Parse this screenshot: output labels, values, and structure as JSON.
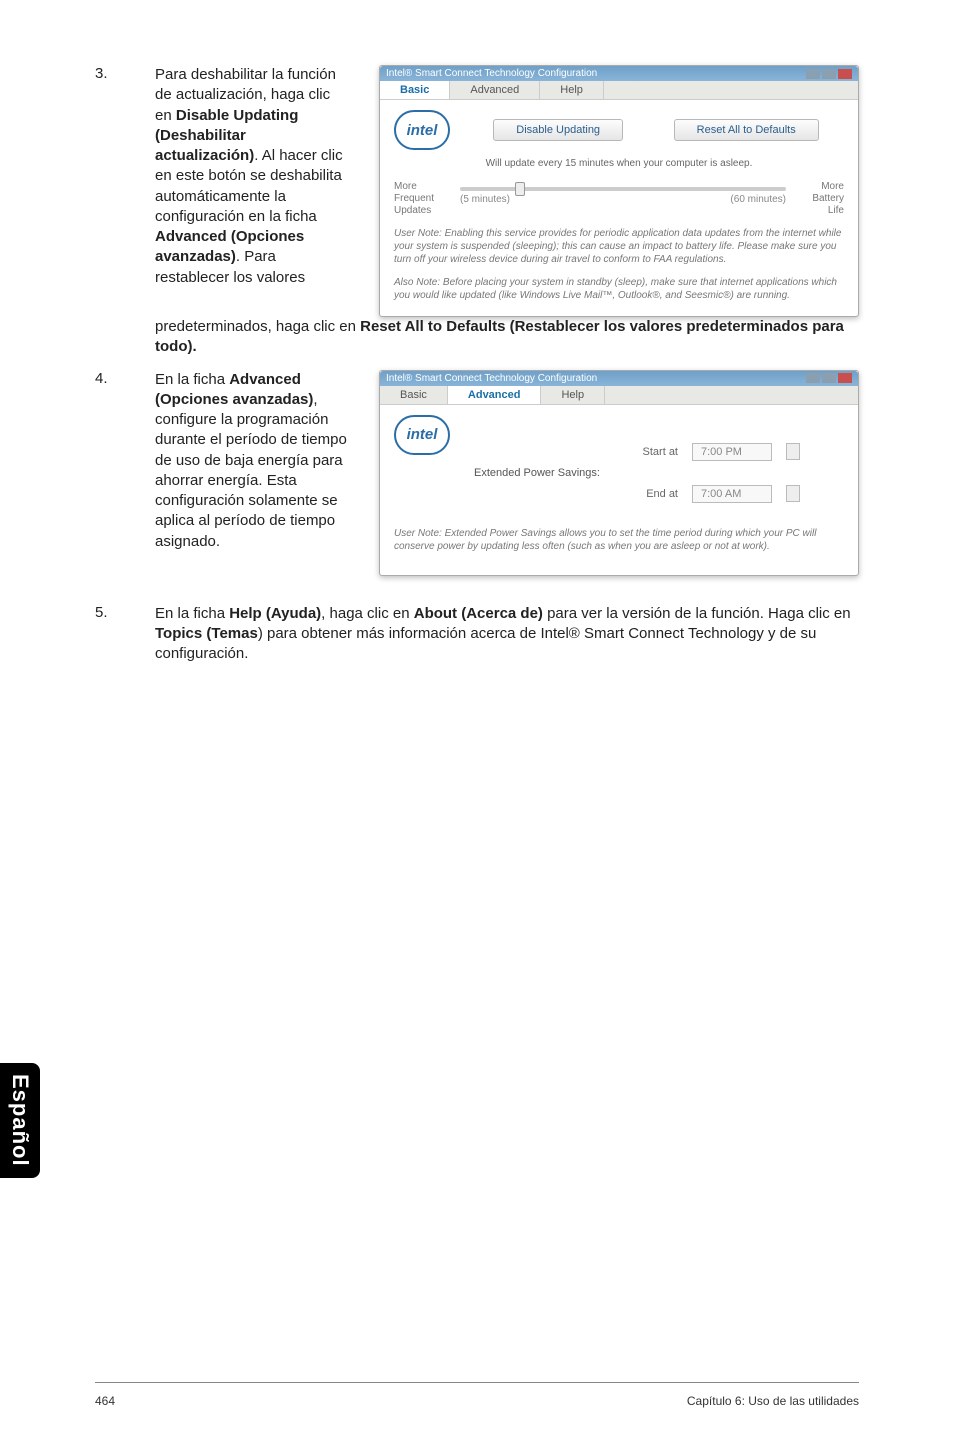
{
  "step3": {
    "num": "3.",
    "text_before": "Para deshabilitar la función de actualización, haga clic en ",
    "bold1": "Disable Updating (Deshabilitar actualización)",
    "text_mid": ". Al hacer clic en este botón se deshabilita automáticamente la configuración en la ficha ",
    "bold2": "Advanced (Opciones avanzadas)",
    "text_after": ". Para restablecer los valores",
    "wide_before": "predeterminados, haga clic en ",
    "bold3": "Reset All to Defaults (Restablecer los valores predeterminados para todo)."
  },
  "step4": {
    "num": "4.",
    "text_before": "En la ficha ",
    "bold1": "Advanced (Opciones avanzadas)",
    "text_after": ", configure la programación durante el período de tiempo de uso de baja energía para ahorrar energía. Esta configuración solamente se aplica al período de tiempo asignado."
  },
  "step5": {
    "num": "5.",
    "t1": "En la ficha ",
    "b1": "Help (Ayuda)",
    "t2": ", haga clic en ",
    "b2": "About (Acerca de)",
    "t3": " para ver la versión de la función. Haga clic en ",
    "b3": "Topics (Temas",
    "t4": ") para obtener más información acerca de Intel® Smart Connect Technology y de su configuración."
  },
  "shot1": {
    "title": "Intel® Smart Connect Technology Configuration",
    "tab_basic": "Basic",
    "tab_adv": "Advanced",
    "tab_help": "Help",
    "btn_disable": "Disable Updating",
    "btn_reset": "Reset All to Defaults",
    "subtitle": "Will update every 15 minutes when your computer is asleep.",
    "left_lbl": "More Frequent Updates",
    "left_scale": "(5 minutes)",
    "right_lbl": "More Battery Life",
    "right_scale": "(60 minutes)",
    "note1": "User Note: Enabling this service provides for periodic application data updates from the internet while your system is suspended (sleeping); this can cause an impact to battery life. Please make sure you turn off your wireless device during air travel to conform to FAA regulations.",
    "note2": "Also Note: Before placing your system in standby (sleep), make sure that internet applications which you would like updated (like Windows Live Mail™, Outlook®, and Seesmic®) are running."
  },
  "shot2": {
    "title": "Intel® Smart Connect Technology Configuration",
    "tab_basic": "Basic",
    "tab_adv": "Advanced",
    "tab_help": "Help",
    "section": "Extended Power Savings:",
    "start_lbl": "Start at",
    "start_val": "7:00 PM",
    "end_lbl": "End at",
    "end_val": "7:00 AM",
    "note": "User Note: Extended Power Savings allows you to set the time period during which your PC will conserve power by updating less often (such as when you are asleep or not at work)."
  },
  "side_tab": "Español",
  "footer": {
    "page": "464",
    "chapter": "Capítulo 6: Uso de las utilidades"
  }
}
